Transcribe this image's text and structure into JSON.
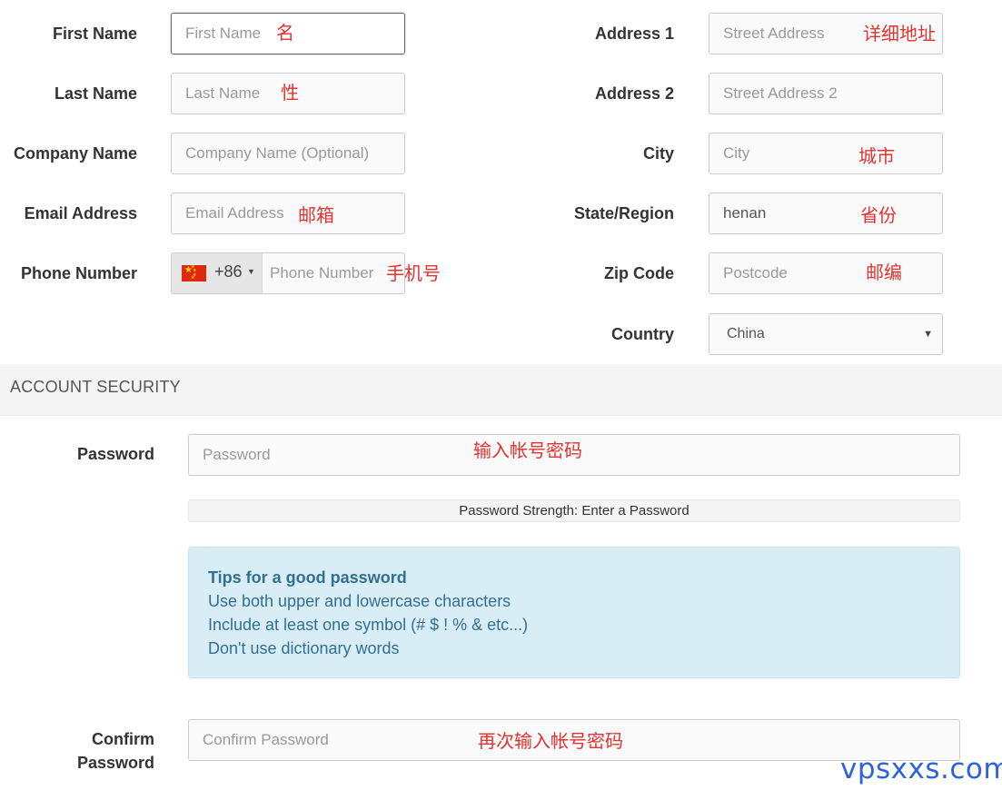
{
  "personal": {
    "first_name": {
      "label": "First Name",
      "placeholder": "First Name",
      "annotation": "名"
    },
    "last_name": {
      "label": "Last Name",
      "placeholder": "Last Name",
      "annotation": "性"
    },
    "company_name": {
      "label": "Company Name",
      "placeholder": "Company Name (Optional)"
    },
    "email": {
      "label": "Email Address",
      "placeholder": "Email Address",
      "annotation": "邮箱"
    },
    "phone": {
      "label": "Phone Number",
      "dial_code": "+86",
      "placeholder": "Phone Number",
      "annotation": "手机号",
      "flag_icon": "china-flag-icon"
    }
  },
  "address": {
    "address1": {
      "label": "Address 1",
      "placeholder": "Street Address",
      "annotation": "详细地址"
    },
    "address2": {
      "label": "Address 2",
      "placeholder": "Street Address 2"
    },
    "city": {
      "label": "City",
      "placeholder": "City",
      "annotation": "城市"
    },
    "state": {
      "label": "State/Region",
      "value": "henan",
      "annotation": "省份"
    },
    "zip": {
      "label": "Zip Code",
      "placeholder": "Postcode",
      "annotation": "邮编"
    },
    "country": {
      "label": "Country",
      "value": "China"
    }
  },
  "security": {
    "section_title": "ACCOUNT SECURITY",
    "password": {
      "label": "Password",
      "placeholder": "Password",
      "annotation": "输入帐号密码"
    },
    "strength_text": "Password Strength: Enter a Password",
    "tips": {
      "title": "Tips for a good password",
      "lines": [
        "Use both upper and lowercase characters",
        "Include at least one symbol (# $ ! % & etc...)",
        "Don't use dictionary words"
      ]
    },
    "confirm": {
      "label_line1": "Confirm",
      "label_line2": "Password",
      "placeholder": "Confirm Password",
      "annotation": "再次输入帐号密码"
    }
  },
  "watermark": "vpsxxs.com",
  "colors": {
    "annotation": "#e3322f",
    "tips_bg": "#d9edf7",
    "tips_text": "#31708f",
    "watermark": "#2f63d8"
  }
}
